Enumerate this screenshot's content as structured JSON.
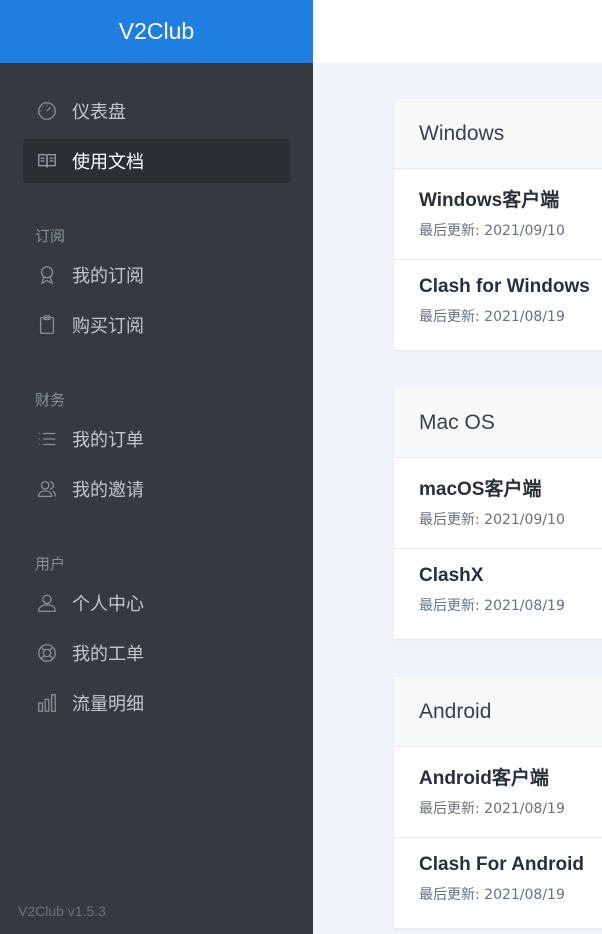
{
  "brand": {
    "title": "V2Club"
  },
  "sidebar": {
    "items": [
      {
        "label": "仪表盘",
        "icon": "dashboard-icon",
        "active": false
      },
      {
        "label": "使用文档",
        "icon": "book-icon",
        "active": true
      }
    ],
    "sections": [
      {
        "title": "订阅",
        "items": [
          {
            "label": "我的订阅",
            "icon": "award-icon"
          },
          {
            "label": "购买订阅",
            "icon": "clipboard-icon"
          }
        ]
      },
      {
        "title": "财务",
        "items": [
          {
            "label": "我的订单",
            "icon": "list-icon"
          },
          {
            "label": "我的邀请",
            "icon": "users-icon"
          }
        ]
      },
      {
        "title": "用户",
        "items": [
          {
            "label": "个人中心",
            "icon": "user-icon"
          },
          {
            "label": "我的工单",
            "icon": "support-icon"
          },
          {
            "label": "流量明细",
            "icon": "bar-chart-icon"
          }
        ]
      }
    ],
    "version": "V2Club v1.5.3"
  },
  "main": {
    "groups": [
      {
        "title": "Windows",
        "items": [
          {
            "name": "Windows客户端",
            "updated": "最后更新: 2021/09/10"
          },
          {
            "name": "Clash for Windows",
            "updated": "最后更新: 2021/08/19"
          }
        ]
      },
      {
        "title": "Mac OS",
        "items": [
          {
            "name": "macOS客户端",
            "updated": "最后更新: 2021/09/10"
          },
          {
            "name": "ClashX",
            "updated": "最后更新: 2021/08/19"
          }
        ]
      },
      {
        "title": "Android",
        "items": [
          {
            "name": "Android客户端",
            "updated": "最后更新: 2021/08/19"
          },
          {
            "name": "Clash For Android",
            "updated": "最后更新: 2021/08/19"
          }
        ]
      }
    ]
  }
}
